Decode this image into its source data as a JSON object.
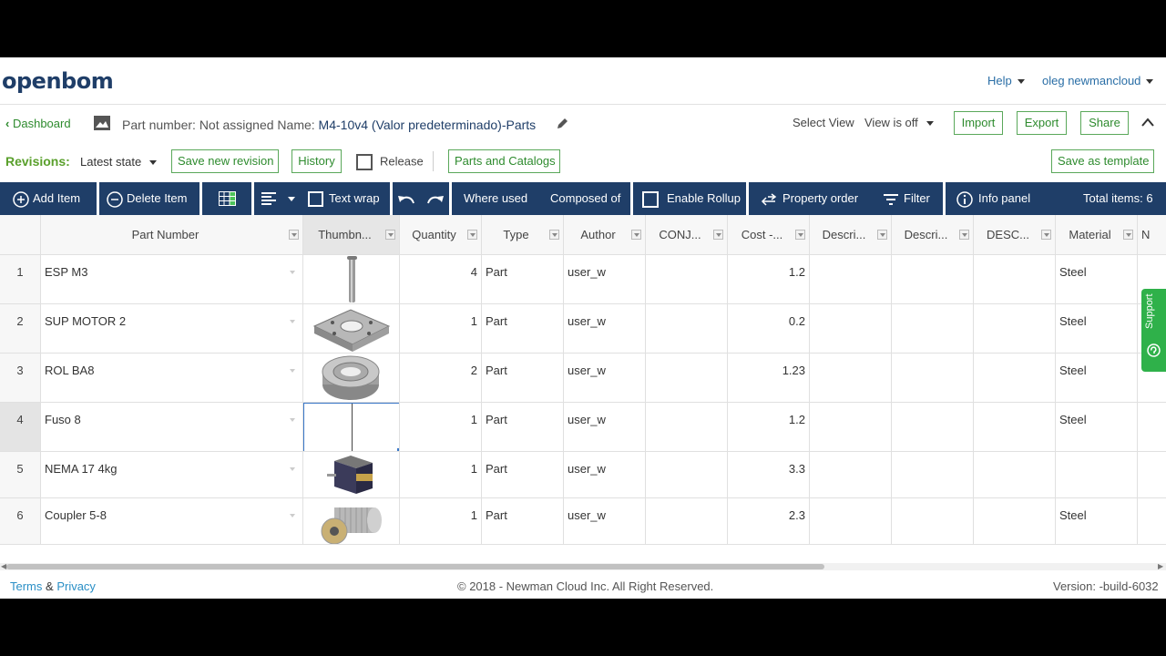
{
  "brand": {
    "logo": "openbom"
  },
  "topbar": {
    "help": "Help",
    "user": "oleg newmancloud"
  },
  "header": {
    "dashboard": "Dashboard",
    "part_label": "Part number: Not assigned Name: ",
    "bom_name": "M4-10v4 (Valor predeterminado)-Parts",
    "select_view": "Select View",
    "view_value": "View is off",
    "import": "Import",
    "export": "Export",
    "share": "Share"
  },
  "revisions": {
    "label": "Revisions:",
    "state": "Latest state",
    "save_new": "Save new revision",
    "history": "History",
    "release": "Release",
    "parts_catalogs": "Parts and Catalogs",
    "save_template": "Save as template"
  },
  "toolbar": {
    "add_item": "Add Item",
    "delete_item": "Delete Item",
    "text_wrap": "Text wrap",
    "where_used": "Where used",
    "composed_of": "Composed of",
    "enable_rollup": "Enable Rollup",
    "property_order": "Property order",
    "filter": "Filter",
    "info_panel": "Info panel",
    "total_items": "Total items: 6"
  },
  "table": {
    "columns": [
      "Part Number",
      "Thumbn...",
      "Quantity",
      "Type",
      "Author",
      "CONJ...",
      "Cost -...",
      "Descri...",
      "Descri...",
      "DESC...",
      "Material",
      "N"
    ],
    "rows": [
      {
        "num": "1",
        "part": "ESP M3",
        "thumb": "screw",
        "qty": "4",
        "type": "Part",
        "author": "user_w",
        "cost": "1.2",
        "material": "Steel"
      },
      {
        "num": "2",
        "part": "SUP MOTOR 2",
        "thumb": "bracket",
        "qty": "1",
        "type": "Part",
        "author": "user_w",
        "cost": "0.2",
        "material": "Steel"
      },
      {
        "num": "3",
        "part": "ROL BA8",
        "thumb": "bearing",
        "qty": "2",
        "type": "Part",
        "author": "user_w",
        "cost": "1.23",
        "material": "Steel"
      },
      {
        "num": "4",
        "part": "Fuso 8",
        "thumb": "",
        "qty": "1",
        "type": "Part",
        "author": "user_w",
        "cost": "1.2",
        "material": "Steel"
      },
      {
        "num": "5",
        "part": "NEMA 17 4kg",
        "thumb": "motor",
        "qty": "1",
        "type": "Part",
        "author": "user_w",
        "cost": "3.3",
        "material": ""
      },
      {
        "num": "6",
        "part": "Coupler 5-8",
        "thumb": "coupler",
        "qty": "1",
        "type": "Part",
        "author": "user_w",
        "cost": "2.3",
        "material": "Steel"
      }
    ]
  },
  "support": {
    "label": "Support"
  },
  "footer": {
    "terms": "Terms",
    "amp": "&",
    "privacy": "Privacy",
    "copyright": "© 2018 - Newman Cloud Inc. All Right Reserved.",
    "version": "Version: -build-6032"
  },
  "colors": {
    "toolbar": "#1f3e68",
    "accent_green": "#2e8b2e",
    "link_blue": "#2a6ea6",
    "support": "#2fb14a"
  }
}
